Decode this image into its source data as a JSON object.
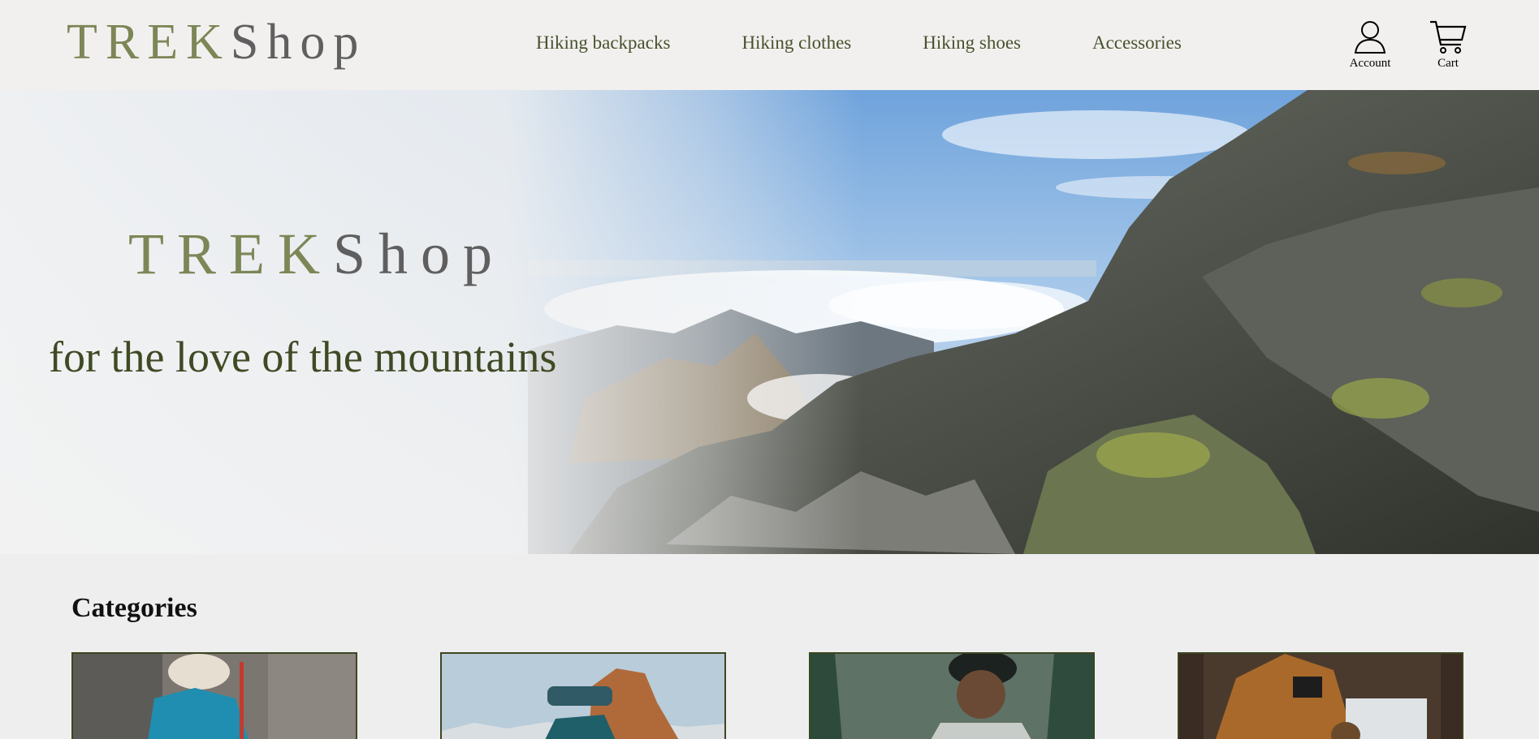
{
  "brand": {
    "trek": "TREK",
    "shop": "Shop"
  },
  "nav": {
    "items": [
      {
        "label": "Hiking backpacks"
      },
      {
        "label": "Hiking clothes"
      },
      {
        "label": "Hiking shoes"
      },
      {
        "label": "Accessories"
      }
    ]
  },
  "header_icons": {
    "account": {
      "label": "Account",
      "icon": "user-icon"
    },
    "cart": {
      "label": "Cart",
      "icon": "cart-icon"
    }
  },
  "hero": {
    "logo_trek": "TREK",
    "logo_shop": "Shop",
    "tagline": "for the love of the mountains"
  },
  "categories": {
    "title": "Categories",
    "cards": [
      {
        "image": "hiker-backpack-photo"
      },
      {
        "image": "hiker-headband-photo"
      },
      {
        "image": "woman-beanie-photo"
      },
      {
        "image": "jacket-map-photo"
      }
    ]
  },
  "colors": {
    "brand_green": "#7d8656",
    "brand_gray": "#5f5f5f",
    "nav_text": "#47522d",
    "header_bg": "#f2f0ef",
    "page_bg": "#eeeeee",
    "card_border": "#3b4620"
  }
}
